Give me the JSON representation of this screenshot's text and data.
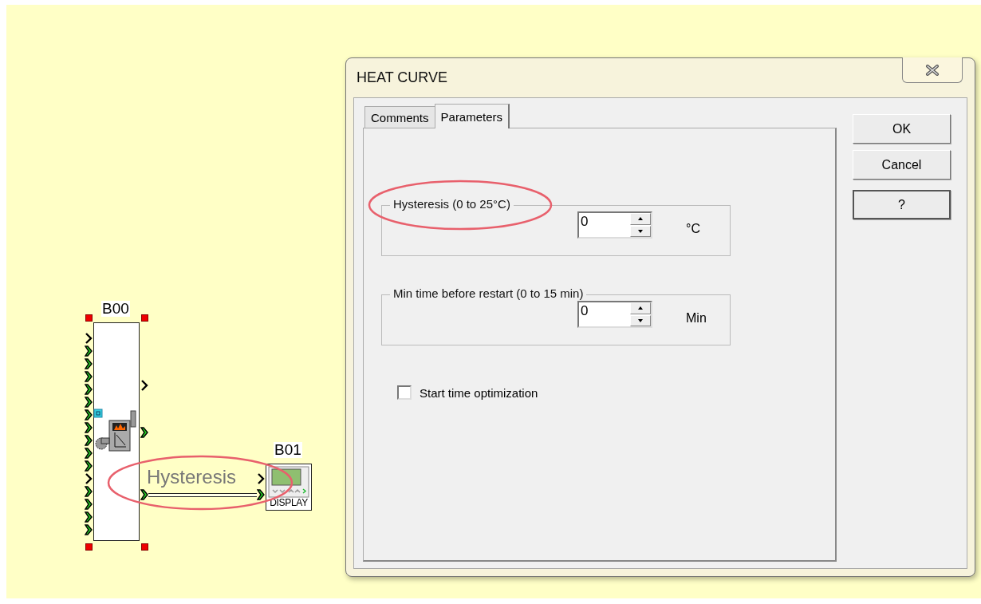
{
  "canvas": {
    "blocks": [
      {
        "label": "B00",
        "kind": "boiler",
        "inputs": [
          {
            "connected": false
          },
          {
            "connected": true
          },
          {
            "connected": true
          },
          {
            "connected": true
          },
          {
            "connected": true
          },
          {
            "connected": true
          },
          {
            "connected": true
          },
          {
            "connected": true
          },
          {
            "connected": true
          },
          {
            "connected": true
          },
          {
            "connected": true
          },
          {
            "connected": false
          },
          {
            "connected": true
          },
          {
            "connected": true
          },
          {
            "connected": true
          },
          {
            "connected": true
          }
        ],
        "outputs": [
          {
            "connected": false
          },
          {
            "connected": true
          },
          {
            "connected": true
          }
        ]
      },
      {
        "label": "B01",
        "kind": "display",
        "caption": "DISPLAY",
        "inputs": [
          {
            "connected": false
          },
          {
            "connected": true
          }
        ]
      }
    ],
    "link": {
      "label": "Hysteresis",
      "highlighted": true
    }
  },
  "dialog": {
    "title": "HEAT CURVE",
    "tabs": [
      {
        "label": "Comments",
        "selected": false
      },
      {
        "label": "Parameters",
        "selected": true
      }
    ],
    "groups": [
      {
        "legend": "Hysteresis (0 to 25°C)",
        "value": "0",
        "unit": "°C",
        "highlighted": true
      },
      {
        "legend": "Min time before restart (0 to 15 min)",
        "value": "0",
        "unit": "Min",
        "highlighted": false
      }
    ],
    "checkbox": {
      "label": "Start time optimization",
      "checked": false
    },
    "buttons": [
      {
        "label": "OK",
        "default": false
      },
      {
        "label": "Cancel",
        "default": false
      },
      {
        "label": "?",
        "default": true
      }
    ]
  }
}
